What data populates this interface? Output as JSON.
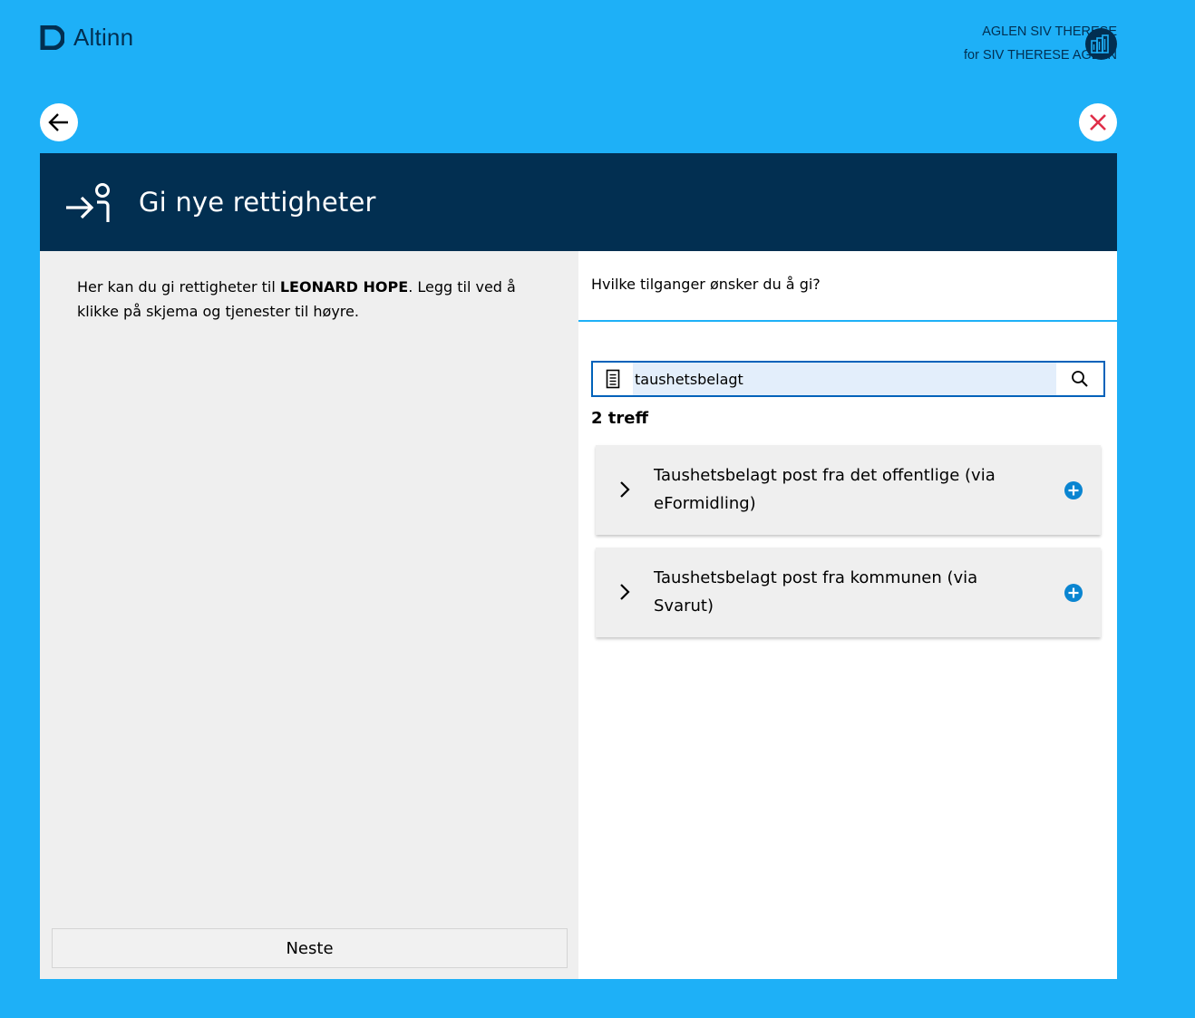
{
  "brand": {
    "name": "Altinn",
    "color": "#022f51",
    "background": "#1eb0f7"
  },
  "user": {
    "name": "AGLEN SIV THERESE",
    "acting_for": "for SIV THERESE AGLEN",
    "avatar_icon": "building-icon"
  },
  "nav": {
    "back_icon": "arrow-left-icon",
    "close_icon": "close-icon"
  },
  "modal": {
    "title": "Gi nye rettigheter",
    "title_icon": "give-rights-icon"
  },
  "left": {
    "intro_before": "Her kan du gi rettigheter til ",
    "intro_name": "LEONARD HOPE",
    "intro_after": ". Legg til ved å klikke på skjema og tjenester til høyre.",
    "next_label": "Neste"
  },
  "right": {
    "question": "Hvilke tilganger ønsker du å gi?",
    "search": {
      "value": "taushetsbelagt",
      "doc_icon": "document-icon",
      "search_icon": "search-icon"
    },
    "hits_label": "2 treff",
    "results": [
      {
        "line1": "Taushetsbelagt post fra det offentlige (via",
        "line2": "eFormidling)"
      },
      {
        "line1": "Taushetsbelagt post fra kommunen (via",
        "line2": "Svarut)"
      }
    ]
  }
}
